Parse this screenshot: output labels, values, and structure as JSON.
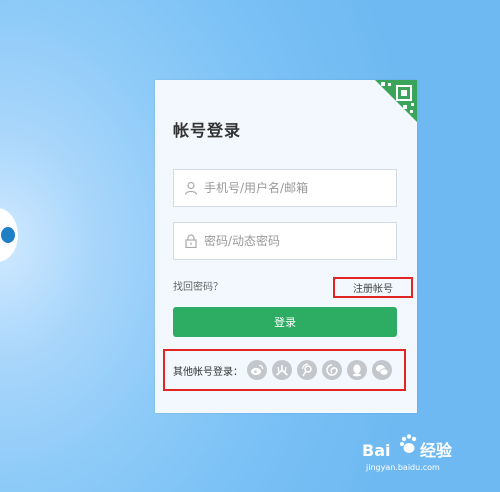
{
  "login": {
    "title": "帐号登录",
    "username_placeholder": "手机号/用户名/邮箱",
    "password_placeholder": "密码/动态密码",
    "forgot_password": "找回密码？",
    "register": "注册帐号",
    "login_button": "登录",
    "other_login_label": "其他帐号登录：",
    "social_icons": [
      "weibo-icon",
      "renren-icon",
      "tencent-weibo-icon",
      "netease-icon",
      "qq-icon",
      "wechat-icon"
    ]
  },
  "watermark": {
    "logo_text": "Bai du 经验",
    "url": "jingyan.baidu.com"
  },
  "colors": {
    "background": "#78c0f5",
    "card": "#f2f8fe",
    "login_button": "#2dac63",
    "highlight_box": "#e32424",
    "qr_corner": "#3aa55a",
    "social_icon": "#c3c7cc"
  }
}
